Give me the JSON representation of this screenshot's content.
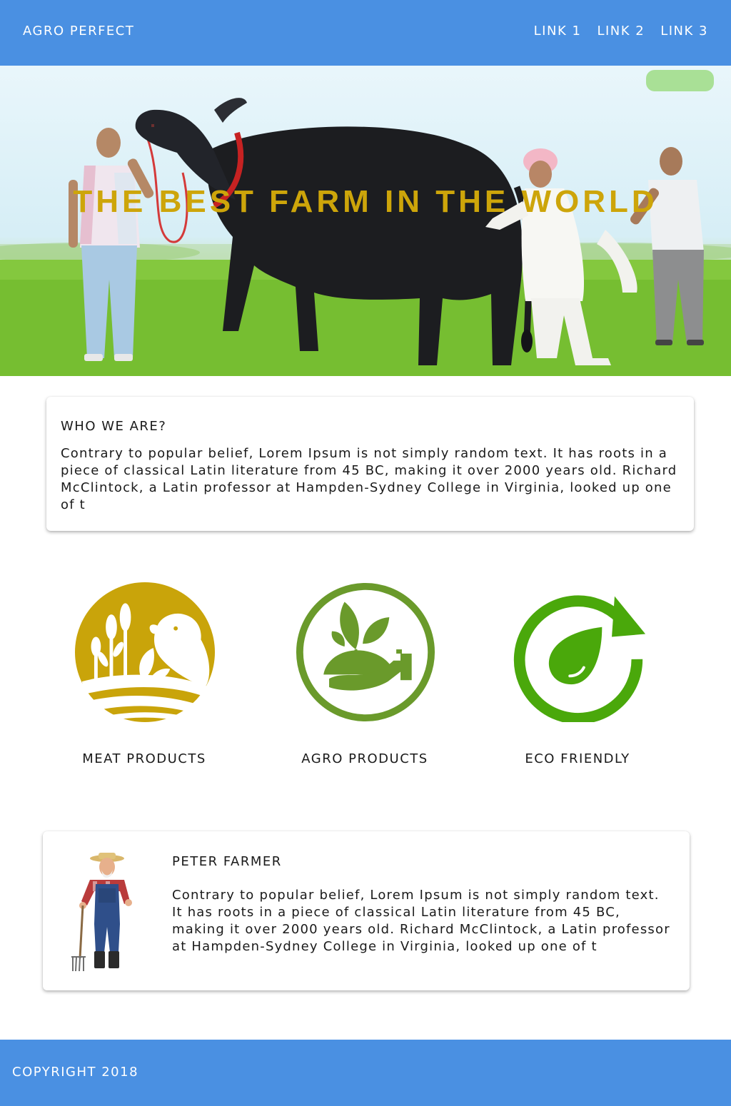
{
  "header": {
    "brand": "AGRO PERFECT",
    "links": [
      "LINK 1",
      "LINK 2",
      "LINK 3"
    ]
  },
  "hero": {
    "title": "THE BEST FARM IN THE WORLD"
  },
  "about": {
    "heading": "WHO WE ARE?",
    "text": "Contrary to popular belief, Lorem Ipsum is not simply random text. It has roots in a piece of classical Latin literature from 45 BC, making it over 2000 years old. Richard McClintock, a Latin professor at Hampden-Sydney College in Virginia, looked up one of t"
  },
  "features": [
    {
      "label": "MEAT PRODUCTS",
      "icon": "wheat-sheep-field-icon",
      "color": "#c9a40a"
    },
    {
      "label": "AGRO PRODUCTS",
      "icon": "hand-plant-icon",
      "color": "#6a9a2b"
    },
    {
      "label": "ECO FRIENDLY",
      "icon": "eco-drop-cycle-icon",
      "color": "#4aa80b"
    }
  ],
  "farmer": {
    "name": "PETER FARMER",
    "text": "Contrary to popular belief, Lorem Ipsum is not simply random text. It has roots in a piece of classical Latin literature from 45 BC, making it over 2000 years old. Richard McClintock, a Latin professor at Hampden-Sydney College in Virginia, looked up one of t"
  },
  "footer": {
    "copyright": "COPYRIGHT 2018"
  },
  "colors": {
    "nav_background": "#4a90e2",
    "hero_title": "#cda50a"
  }
}
